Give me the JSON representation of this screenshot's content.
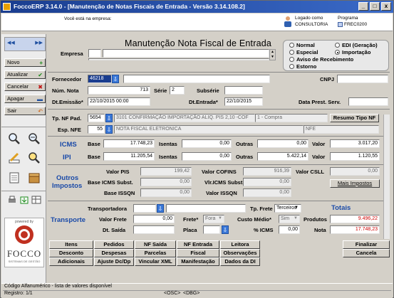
{
  "window": {
    "title": "FoccoERP 3.14.0 - [Manutenção de Notas Fiscais de Entrada - Versão 3.14.108.2]",
    "min": "_",
    "max": "□",
    "close": "x"
  },
  "header": {
    "company_prompt": "Você está na empresa:",
    "user_label": "Logado como",
    "user_value": "CONSULTORIA",
    "program_label": "Programa",
    "program_value": "FREC0200"
  },
  "sidebar": {
    "buttons": [
      {
        "label": "Novo",
        "icon": "plus-icon"
      },
      {
        "label": "Atualizar",
        "icon": "check-icon"
      },
      {
        "label": "Cancelar",
        "icon": "cancel-icon"
      },
      {
        "label": "Apagar",
        "icon": "delete-icon"
      },
      {
        "label": "Sair",
        "icon": "exit-icon"
      }
    ],
    "logo_text": "FOCCO",
    "logo_sub": "SISTEMAS DE GESTÃO",
    "logo_top": "powered by"
  },
  "form": {
    "title": "Manutenção Nota Fiscal de Entrada",
    "empresa_label": "Empresa",
    "type_options": [
      {
        "label": "Normal",
        "selected": false
      },
      {
        "label": "Especial",
        "selected": false
      },
      {
        "label": "Aviso de Recebimento",
        "selected": false
      },
      {
        "label": "Estorno",
        "selected": false
      },
      {
        "label": "EDI (Geração)",
        "selected": false
      },
      {
        "label": "Importação",
        "selected": true
      }
    ],
    "fornecedor_label": "Fornecedor",
    "fornecedor_value": "46218",
    "cnpj_label": "CNPJ",
    "num_nota_label": "Núm. Nota",
    "num_nota_value": "713",
    "serie_label": "Série",
    "serie_value": "2",
    "subserie_label": "Subsérie",
    "dt_emissao_label": "Dt.Emissão*",
    "dt_emissao_value": "22/10/2015 00:00",
    "dt_entrada_label": "Dt.Entrada*",
    "dt_entrada_value": "22/10/2015",
    "data_prest_label": "Data Prest. Serv.",
    "tp_nf_label": "Tp. NF Pad.",
    "tp_nf_code": "5654",
    "tp_nf_desc": "3101 CONFIRMAÇÃO IMPORTAÇÃO ALIQ. PIS 2,10 -COF",
    "tp_nf_compra": "1 - Compra",
    "resumo_btn": "Resumo Tipo NF",
    "esp_nfe_label": "Esp. NFE",
    "esp_nfe_code": "55",
    "esp_nfe_desc": "NOTA FISCAL ELETRONICA",
    "esp_nfe_type": "NFE"
  },
  "icms": {
    "title": "ICMS",
    "base_label": "Base",
    "base": "17.748,23",
    "isentas_label": "Isentas",
    "isentas": "0,00",
    "outras_label": "Outras",
    "outras": "0,00",
    "valor_label": "Valor",
    "valor": "3.017,20"
  },
  "ipi": {
    "title": "IPI",
    "base_label": "Base",
    "base": "11.205,54",
    "isentas_label": "Isentas",
    "isentas": "0,00",
    "outras_label": "Outras",
    "outras": "5.422,14",
    "valor_label": "Valor",
    "valor": "1.120,55"
  },
  "outros": {
    "title1": "Outros",
    "title2": "Impostos",
    "valor_pis_label": "Valor PIS",
    "valor_pis": "199,42",
    "valor_cofins_label": "Valor COFINS",
    "valor_cofins": "916,39",
    "valor_csll_label": "Valor CSLL",
    "valor_csll": "0,00",
    "base_icms_subst_label": "Base ICMS Subst.",
    "base_icms_subst": "0,00",
    "vlr_icms_subst_label": "Vlr.ICMS Subst.",
    "vlr_icms_subst": "0,00",
    "base_issqn_label": "Base ISSQN",
    "base_issqn": "0,00",
    "valor_issqn_label": "Valor ISSQN",
    "valor_issqn": "0,00",
    "mais_btn": "Mais Impostos"
  },
  "transporte": {
    "title": "Transporte",
    "transportadora_label": "Transportadora",
    "tp_frete_label": "Tp. Frete",
    "tp_frete": "Terceiros",
    "valor_frete_label": "Valor Frete",
    "valor_frete": "0,00",
    "frete_label": "Frete*",
    "frete": "Fora",
    "custo_medio_label": "Custo Médio*",
    "custo_medio": "Sim",
    "dt_saida_label": "Dt. Saída",
    "placa_label": "Placa",
    "pct_icms_label": "% ICMS",
    "pct_icms": "0,00"
  },
  "totais": {
    "title": "Totais",
    "produtos_label": "Produtos",
    "produtos": "9.496,22",
    "nota_label": "Nota",
    "nota": "17.748,23"
  },
  "bottom_buttons": [
    [
      "Itens",
      "Pedidos",
      "NF Saída",
      "NF Entrada",
      "Leitora"
    ],
    [
      "Desconto",
      "Despesas",
      "Parcelas",
      "Fiscal",
      "Observações"
    ],
    [
      "Adicionais",
      "Ajuste Dc/Dp",
      "Vincular XML",
      "Manifestação",
      "Dados da DI"
    ]
  ],
  "actions": {
    "finalizar": "Finalizar",
    "cancela": "Cancela"
  },
  "status": {
    "hint": "Código Alfanumérico - lista de valores disponível",
    "registro": "Registro: 1/1",
    "osc": "<OSC>",
    "dbg": "<DBG>"
  },
  "colors": {
    "title_bar": "#1a3d8f",
    "section_blue": "#1a4aa8",
    "highlight": "#cc0000"
  }
}
